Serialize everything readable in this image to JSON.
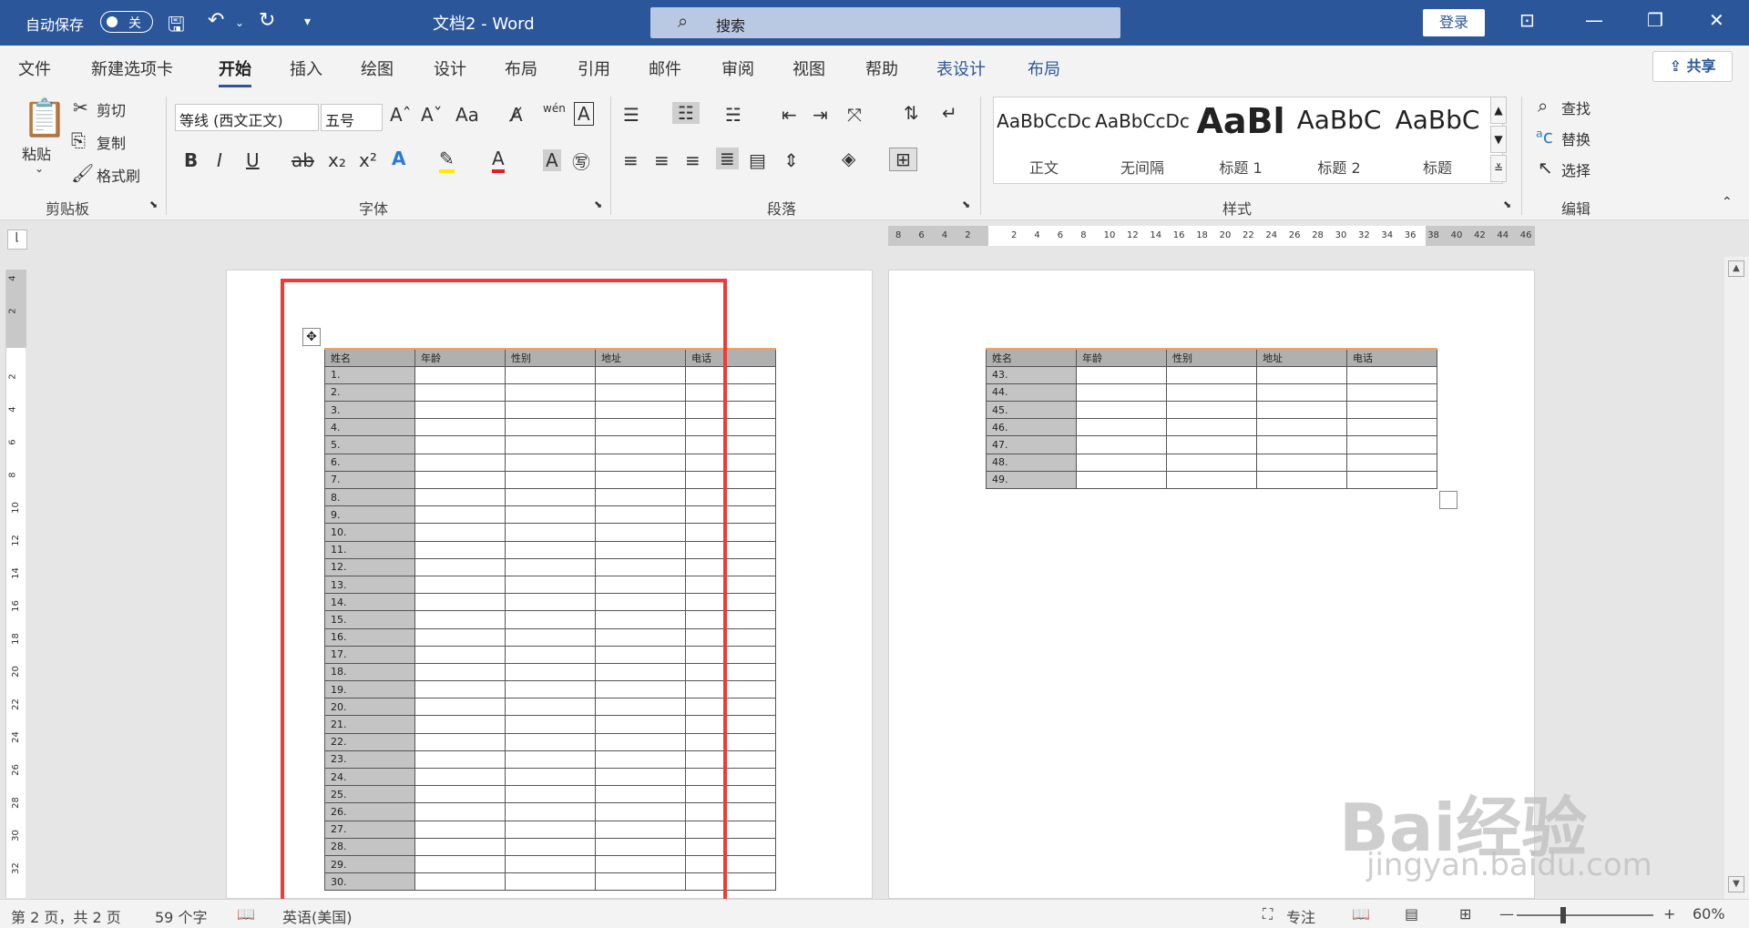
{
  "titlebar": {
    "autosave": "自动保存",
    "autosave_state": "关",
    "doc_title": "文档2  -  Word",
    "search_placeholder": "搜索",
    "login": "登录"
  },
  "tabs": [
    "文件",
    "新建选项卡",
    "开始",
    "插入",
    "绘图",
    "设计",
    "布局",
    "引用",
    "邮件",
    "审阅",
    "视图",
    "帮助",
    "表设计",
    "布局"
  ],
  "active_tab": "开始",
  "share": "共享",
  "clipboard": {
    "paste": "粘贴",
    "cut": "剪切",
    "copy": "复制",
    "format_painter": "格式刷",
    "label": "剪贴板"
  },
  "font": {
    "name": "等线 (西文正文)",
    "size": "五号",
    "label": "字体"
  },
  "paragraph": {
    "label": "段落"
  },
  "styles": {
    "label": "样式",
    "items": [
      {
        "preview": "AaBbCcDc",
        "name": "正文"
      },
      {
        "preview": "AaBbCcDc",
        "name": "无间隔"
      },
      {
        "preview": "AaBl",
        "name": "标题 1"
      },
      {
        "preview": "AaBbC",
        "name": "标题 2"
      },
      {
        "preview": "AaBbC",
        "name": "标题"
      }
    ]
  },
  "editing": {
    "find": "查找",
    "replace": "替换",
    "select": "选择",
    "label": "编辑"
  },
  "ruler_h": [
    "8",
    "6",
    "4",
    "2",
    "",
    "2",
    "4",
    "6",
    "8",
    "10",
    "12",
    "14",
    "16",
    "18",
    "20",
    "22",
    "24",
    "26",
    "28",
    "30",
    "32",
    "34",
    "36",
    "38",
    "40",
    "42",
    "44",
    "46"
  ],
  "ruler_v": [
    "4",
    "2",
    "",
    "2",
    "4",
    "6",
    "8",
    "10",
    "12",
    "14",
    "16",
    "18",
    "20",
    "22",
    "24",
    "26",
    "28",
    "30",
    "32"
  ],
  "table": {
    "headers": [
      "姓名",
      "年龄",
      "性别",
      "地址",
      "电话"
    ],
    "page1_rows": [
      "1.",
      "2.",
      "3.",
      "4.",
      "5.",
      "6.",
      "7.",
      "8.",
      "9.",
      "10.",
      "11.",
      "12.",
      "13.",
      "14.",
      "15.",
      "16.",
      "17.",
      "18.",
      "19.",
      "20.",
      "21.",
      "22.",
      "23.",
      "24.",
      "25.",
      "26.",
      "27.",
      "28.",
      "29.",
      "30."
    ],
    "page2_rows": [
      "43.",
      "44.",
      "45.",
      "46.",
      "47.",
      "48.",
      "49."
    ]
  },
  "statusbar": {
    "page": "第 2 页，共 2 页",
    "words": "59 个字",
    "language": "英语(美国)",
    "focus": "专注",
    "zoom": "60%"
  },
  "watermark": {
    "brand": "Bai经验",
    "url": "jingyan.baidu.com"
  }
}
